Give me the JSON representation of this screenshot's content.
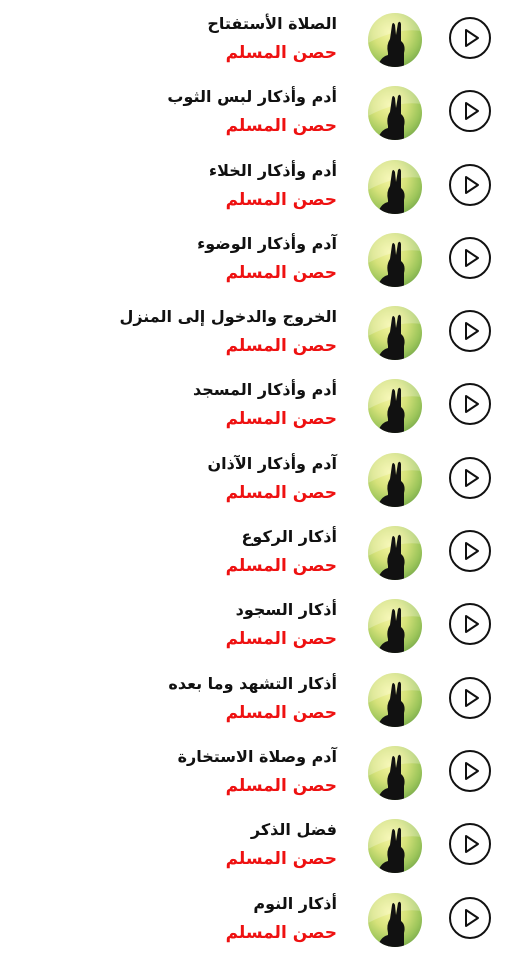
{
  "tracks": [
    {
      "title": "الصلاة الأستفتاح",
      "artist": "حصن المسلم"
    },
    {
      "title": "أدم وأذكار لبس الثوب",
      "artist": "حصن المسلم"
    },
    {
      "title": "أدم وأذكار الخلاء",
      "artist": "حصن المسلم"
    },
    {
      "title": "آدم وأذكار الوضوء",
      "artist": "حصن المسلم"
    },
    {
      "title": "الخروج والدخول إلى المنزل",
      "artist": "حصن المسلم"
    },
    {
      "title": "أدم وأذكار المسجد",
      "artist": "حصن المسلم"
    },
    {
      "title": "آدم وأذكار الآذان",
      "artist": "حصن المسلم"
    },
    {
      "title": "أذكار الركوع",
      "artist": "حصن المسلم"
    },
    {
      "title": "أذكار السجود",
      "artist": "حصن المسلم"
    },
    {
      "title": "أذكار التشهد وما بعده",
      "artist": "حصن المسلم"
    },
    {
      "title": "آدم وصلاة الاستخارة",
      "artist": "حصن المسلم"
    },
    {
      "title": "فضل الذكر",
      "artist": "حصن المسلم"
    },
    {
      "title": "أذكار النوم",
      "artist": "حصن المسلم"
    }
  ],
  "icons": {
    "play": "play-icon",
    "avatar": "praying-hands-avatar-icon"
  },
  "colors": {
    "title": "#111111",
    "artist": "#ee1111",
    "background": "#ffffff"
  }
}
